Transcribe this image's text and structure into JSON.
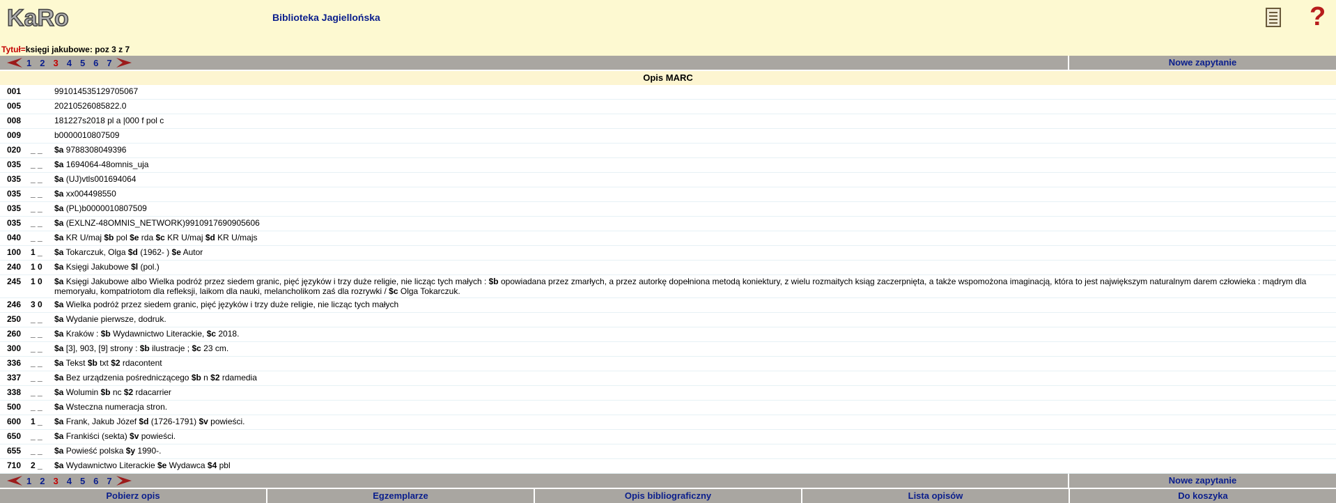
{
  "header": {
    "logo_text": "KaRo",
    "library_name": "Biblioteka Jagiellońska"
  },
  "query": {
    "label": "Tytuł=",
    "value": "księgi jakubowe: poz 3 z 7"
  },
  "pager": {
    "pages": [
      "1",
      "2",
      "3",
      "4",
      "5",
      "6",
      "7"
    ],
    "current": "3",
    "new_query": "Nowe zapytanie"
  },
  "section_title": "Opis MARC",
  "records": [
    {
      "tag": "001",
      "ind": "",
      "parts": [
        {
          "t": "991014535129705067"
        }
      ]
    },
    {
      "tag": "005",
      "ind": "",
      "parts": [
        {
          "t": "20210526085822.0"
        }
      ]
    },
    {
      "tag": "008",
      "ind": "",
      "parts": [
        {
          "t": "181227s2018 pl a |000 f pol c"
        }
      ]
    },
    {
      "tag": "009",
      "ind": "",
      "parts": [
        {
          "t": "b0000010807509"
        }
      ]
    },
    {
      "tag": "020",
      "ind": "_ _",
      "parts": [
        {
          "c": "$a"
        },
        {
          "t": " 9788308049396"
        }
      ]
    },
    {
      "tag": "035",
      "ind": "_ _",
      "parts": [
        {
          "c": "$a"
        },
        {
          "t": " 1694064-48omnis_uja"
        }
      ]
    },
    {
      "tag": "035",
      "ind": "_ _",
      "parts": [
        {
          "c": "$a"
        },
        {
          "t": " (UJ)vtls001694064"
        }
      ]
    },
    {
      "tag": "035",
      "ind": "_ _",
      "parts": [
        {
          "c": "$a"
        },
        {
          "t": " xx004498550"
        }
      ]
    },
    {
      "tag": "035",
      "ind": "_ _",
      "parts": [
        {
          "c": "$a"
        },
        {
          "t": " (PL)b0000010807509"
        }
      ]
    },
    {
      "tag": "035",
      "ind": "_ _",
      "parts": [
        {
          "c": "$a"
        },
        {
          "t": " (EXLNZ-48OMNIS_NETWORK)9910917690905606"
        }
      ]
    },
    {
      "tag": "040",
      "ind": "_ _",
      "parts": [
        {
          "c": "$a"
        },
        {
          "t": " KR U/maj "
        },
        {
          "c": "$b"
        },
        {
          "t": " pol "
        },
        {
          "c": "$e"
        },
        {
          "t": " rda "
        },
        {
          "c": "$c"
        },
        {
          "t": " KR U/maj "
        },
        {
          "c": "$d"
        },
        {
          "t": " KR U/majs"
        }
      ]
    },
    {
      "tag": "100",
      "ind": "1 _",
      "parts": [
        {
          "c": "$a"
        },
        {
          "t": " Tokarczuk, Olga "
        },
        {
          "c": "$d"
        },
        {
          "t": " (1962- ) "
        },
        {
          "c": "$e"
        },
        {
          "t": " Autor"
        }
      ]
    },
    {
      "tag": "240",
      "ind": "1 0",
      "parts": [
        {
          "c": "$a"
        },
        {
          "t": " Księgi Jakubowe "
        },
        {
          "c": "$l"
        },
        {
          "t": " (pol.)"
        }
      ]
    },
    {
      "tag": "245",
      "ind": "1 0",
      "parts": [
        {
          "c": "$a"
        },
        {
          "t": " Księgi Jakubowe albo Wielka podróż przez siedem granic, pięć języków i trzy duże religie, nie licząc tych małych : "
        },
        {
          "c": "$b"
        },
        {
          "t": " opowiadana przez zmarłych, a przez autorkę dopełniona metodą koniektury, z wielu rozmaitych ksiąg zaczerpnięta, a także wspomożona imaginacją, która to jest największym naturalnym darem człowieka : mądrym dla memoryału, kompatriotom dla refleksji, laikom dla nauki, melancholikom zaś dla rozrywki / "
        },
        {
          "c": "$c"
        },
        {
          "t": " Olga Tokarczuk."
        }
      ]
    },
    {
      "tag": "246",
      "ind": "3 0",
      "parts": [
        {
          "c": "$a"
        },
        {
          "t": " Wielka podróż przez siedem granic, pięć języków i trzy duże religie, nie licząc tych małych"
        }
      ]
    },
    {
      "tag": "250",
      "ind": "_ _",
      "parts": [
        {
          "c": "$a"
        },
        {
          "t": " Wydanie pierwsze, dodruk."
        }
      ]
    },
    {
      "tag": "260",
      "ind": "_ _",
      "parts": [
        {
          "c": "$a"
        },
        {
          "t": " Kraków : "
        },
        {
          "c": "$b"
        },
        {
          "t": " Wydawnictwo Literackie, "
        },
        {
          "c": "$c"
        },
        {
          "t": " 2018."
        }
      ]
    },
    {
      "tag": "300",
      "ind": "_ _",
      "parts": [
        {
          "c": "$a"
        },
        {
          "t": " [3], 903, [9] strony : "
        },
        {
          "c": "$b"
        },
        {
          "t": " ilustracje ; "
        },
        {
          "c": "$c"
        },
        {
          "t": " 23 cm."
        }
      ]
    },
    {
      "tag": "336",
      "ind": "_ _",
      "parts": [
        {
          "c": "$a"
        },
        {
          "t": " Tekst "
        },
        {
          "c": "$b"
        },
        {
          "t": " txt "
        },
        {
          "c": "$2"
        },
        {
          "t": " rdacontent"
        }
      ]
    },
    {
      "tag": "337",
      "ind": "_ _",
      "parts": [
        {
          "c": "$a"
        },
        {
          "t": " Bez urządzenia pośredniczącego "
        },
        {
          "c": "$b"
        },
        {
          "t": " n "
        },
        {
          "c": "$2"
        },
        {
          "t": " rdamedia"
        }
      ]
    },
    {
      "tag": "338",
      "ind": "_ _",
      "parts": [
        {
          "c": "$a"
        },
        {
          "t": " Wolumin "
        },
        {
          "c": "$b"
        },
        {
          "t": " nc "
        },
        {
          "c": "$2"
        },
        {
          "t": " rdacarrier"
        }
      ]
    },
    {
      "tag": "500",
      "ind": "_ _",
      "parts": [
        {
          "c": "$a"
        },
        {
          "t": " Wsteczna numeracja stron."
        }
      ]
    },
    {
      "tag": "600",
      "ind": "1 _",
      "parts": [
        {
          "c": "$a"
        },
        {
          "t": " Frank, Jakub Józef "
        },
        {
          "c": "$d"
        },
        {
          "t": " (1726-1791) "
        },
        {
          "c": "$v"
        },
        {
          "t": " powieści."
        }
      ]
    },
    {
      "tag": "650",
      "ind": "_ _",
      "parts": [
        {
          "c": "$a"
        },
        {
          "t": " Frankiści (sekta) "
        },
        {
          "c": "$v"
        },
        {
          "t": " powieści."
        }
      ]
    },
    {
      "tag": "655",
      "ind": "_ _",
      "parts": [
        {
          "c": "$a"
        },
        {
          "t": " Powieść polska "
        },
        {
          "c": "$y"
        },
        {
          "t": " 1990-."
        }
      ]
    },
    {
      "tag": "710",
      "ind": "2 _",
      "parts": [
        {
          "c": "$a"
        },
        {
          "t": " Wydawnictwo Literackie "
        },
        {
          "c": "$e"
        },
        {
          "t": " Wydawca "
        },
        {
          "c": "$4"
        },
        {
          "t": " pbl"
        }
      ]
    }
  ],
  "bottom_actions": [
    "Pobierz opis",
    "Egzemplarze",
    "Opis bibliograficzny",
    "Lista opisów",
    "Do koszyka"
  ],
  "colors": {
    "header_bg": "#fdf9d1",
    "nav_bg": "#a9a6a1",
    "link": "#0a1e8c",
    "accent_red": "#c40000"
  },
  "icons": {
    "prev": "red-left-arrow-icon",
    "next": "red-right-arrow-icon",
    "manual": "document-icon",
    "help": "question-mark-icon"
  }
}
